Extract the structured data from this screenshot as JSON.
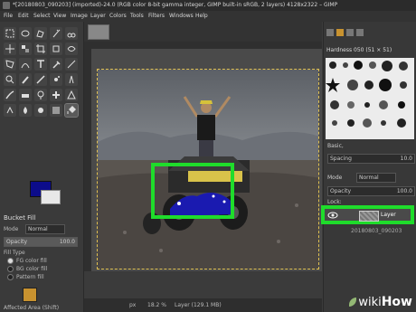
{
  "window": {
    "title": "*[20180803_090203] (imported)-24.0 (RGB color 8-bit gamma integer, GIMP built-in sRGB, 2 layers) 4128x2322 – GIMP"
  },
  "menu": [
    "File",
    "Edit",
    "Select",
    "View",
    "Image",
    "Layer",
    "Colors",
    "Tools",
    "Filters",
    "Windows",
    "Help"
  ],
  "colors": {
    "foreground": "#0c0c8a",
    "background": "#e8e8e8",
    "highlight": "#1fdc2b",
    "pattern": "#c8922f"
  },
  "tool_options": {
    "title": "Bucket Fill",
    "mode_label": "Mode",
    "mode_value": "Normal",
    "opacity_label": "Opacity",
    "opacity_value": "100.0",
    "opacity_fraction": 1.0,
    "fill_type_label": "Fill Type",
    "fill_types": [
      "FG color fill",
      "BG color fill",
      "Pattern fill"
    ],
    "selected_fill_type": "FG color fill",
    "affected_area_label": "Affected Area",
    "affected_area_hint": "(Shift)"
  },
  "status": {
    "units": "px",
    "zoom": "18.2 %",
    "layer_info": "Layer (129.1 MB)"
  },
  "brushes": {
    "header": "Hardness 050 (51 × 51)",
    "preset": "Basic,",
    "spacing_label": "Spacing",
    "spacing_value": "10.0"
  },
  "layers": {
    "mode_label": "Mode",
    "mode_value": "Normal",
    "opacity_label": "Opacity",
    "opacity_value": "100.0",
    "lock_label": "Lock:",
    "active_layer_name": "Layer",
    "second_layer_name": "20180803_090203"
  },
  "watermark": {
    "wiki": "wiki",
    "how": "How"
  }
}
